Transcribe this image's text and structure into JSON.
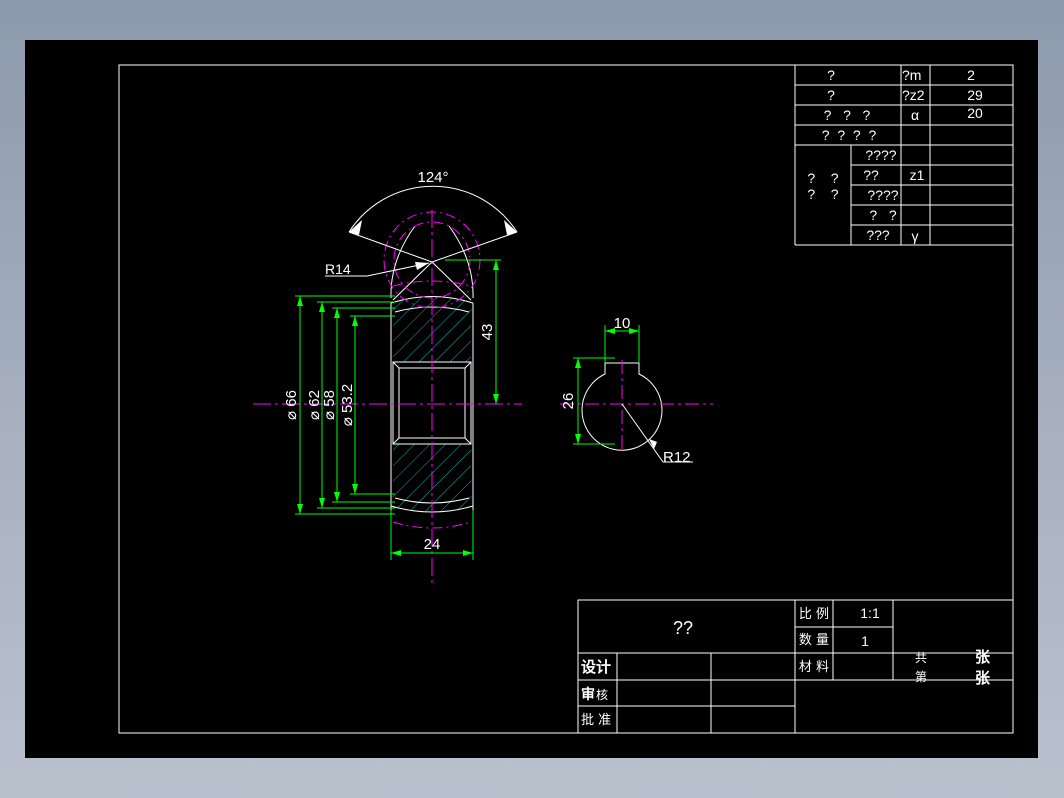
{
  "colors": {
    "background": "#000000",
    "outline": "#ffffff",
    "dimension": "#00ff00",
    "centerline": "#ff00ff",
    "hatch": "#00c8c8",
    "desktop": "#a0abbb"
  },
  "params_table": {
    "rows": [
      {
        "label": "?",
        "symbol": "?m",
        "value": "2"
      },
      {
        "label": "?",
        "symbol": "?z2",
        "value": "29"
      },
      {
        "label": "?   ?   ?",
        "symbol": "α",
        "value": "20"
      },
      {
        "label": "?  ?  ?  ?",
        "symbol": "",
        "value": ""
      }
    ],
    "group_label_1": "?    ?",
    "group_label_2": "?    ?",
    "sub_rows": [
      {
        "label": "????",
        "symbol": "",
        "value": ""
      },
      {
        "label": "??",
        "symbol": "z1",
        "value": ""
      },
      {
        "label": "????",
        "symbol": "",
        "value": ""
      },
      {
        "label": "?   ?",
        "symbol": "",
        "value": ""
      },
      {
        "label": "???",
        "symbol": "γ",
        "value": ""
      }
    ]
  },
  "drawing": {
    "angle_dim": "124°",
    "r14": "R14",
    "dia66": "⌀ 66",
    "dia62": "⌀ 62",
    "dia58": "⌀ 58",
    "dia532": "⌀ 53.2",
    "dim43": "43",
    "dim24": "24",
    "dim10": "10",
    "dim26": "26",
    "r12": "R12"
  },
  "title_block": {
    "name": "??",
    "scale_label": "比 例",
    "scale_value": "1:1",
    "qty_label": "数 量",
    "qty_value": "1",
    "material_label": "材 料",
    "gong": "共",
    "di": "第",
    "zhang1": "张",
    "zhang2": "张",
    "design": "设计",
    "review_a": "审",
    "review_b": "核",
    "approve": "批 准"
  }
}
